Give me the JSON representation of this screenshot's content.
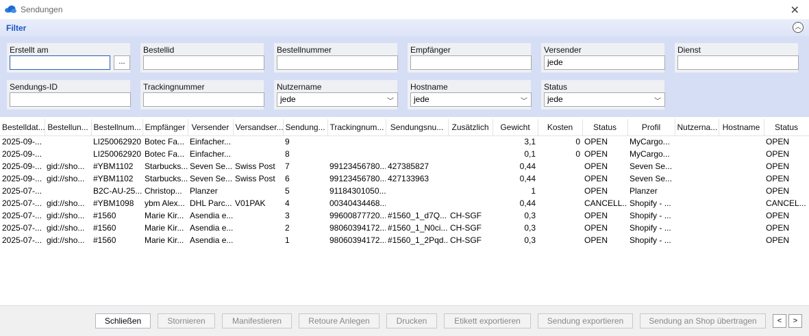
{
  "window": {
    "title": "Sendungen"
  },
  "filter": {
    "title": "Filter",
    "fields": {
      "erstellt_am": {
        "label": "Erstellt am",
        "value": ""
      },
      "bestellid": {
        "label": "Bestellid",
        "value": ""
      },
      "bestellnummer": {
        "label": "Bestellnummer",
        "value": ""
      },
      "empfaenger": {
        "label": "Empfänger",
        "value": ""
      },
      "versender": {
        "label": "Versender",
        "value": "jede"
      },
      "dienst": {
        "label": "Dienst",
        "value": ""
      },
      "sendungs_id": {
        "label": "Sendungs-ID",
        "value": ""
      },
      "trackingnummer": {
        "label": "Trackingnummer",
        "value": ""
      },
      "nutzername": {
        "label": "Nutzername",
        "value": "jede"
      },
      "hostname": {
        "label": "Hostname",
        "value": "jede"
      },
      "status": {
        "label": "Status",
        "value": "jede"
      }
    },
    "date_button": "..."
  },
  "table": {
    "columns": [
      "Bestelldat...",
      "Bestellun...",
      "Bestellnum...",
      "Empfänger",
      "Versender",
      "Versandser...",
      "Sendung...",
      "Trackingnum...",
      "Sendungsnu...",
      "Zusätzlich",
      "Gewicht",
      "Kosten",
      "Status",
      "Profil",
      "Nutzerna...",
      "Hostname",
      "Status"
    ],
    "rows": [
      [
        "2025-09-...",
        "",
        "LI250062920",
        "Botec Fa...",
        "Einfacher...",
        "",
        "9",
        "",
        "",
        "",
        "3,1",
        "0",
        "OPEN",
        "MyCargo...",
        "",
        "",
        "OPEN"
      ],
      [
        "2025-09-...",
        "",
        "LI250062920",
        "Botec Fa...",
        "Einfacher...",
        "",
        "8",
        "",
        "",
        "",
        "0,1",
        "0",
        "OPEN",
        "MyCargo...",
        "",
        "",
        "OPEN"
      ],
      [
        "2025-09-...",
        "gid://sho...",
        "#YBM1102",
        "Starbucks...",
        "Seven Se...",
        "Swiss Post",
        "7",
        "99123456780...",
        "427385827",
        "",
        "0,44",
        "",
        "OPEN",
        "Seven Se...",
        "",
        "",
        "OPEN"
      ],
      [
        "2025-09-...",
        "gid://sho...",
        "#YBM1102",
        "Starbucks...",
        "Seven Se...",
        "Swiss Post",
        "6",
        "99123456780...",
        "427133963",
        "",
        "0,44",
        "",
        "OPEN",
        "Seven Se...",
        "",
        "",
        "OPEN"
      ],
      [
        "2025-07-...",
        "",
        "B2C-AU-25...",
        "Christop...",
        "Planzer",
        "",
        "5",
        "91184301050...",
        "",
        "",
        "1",
        "",
        "OPEN",
        "Planzer",
        "",
        "",
        "OPEN"
      ],
      [
        "2025-07-...",
        "gid://sho...",
        "#YBM1098",
        "ybm Alex...",
        "DHL Parc...",
        "V01PAK",
        "4",
        "00340434468...",
        "",
        "",
        "0,44",
        "",
        "CANCELL...",
        "Shopify - ...",
        "",
        "",
        "CANCEL..."
      ],
      [
        "2025-07-...",
        "gid://sho...",
        "#1560",
        "Marie Kir...",
        "Asendia e...",
        "",
        "3",
        "99600877720...",
        "#1560_1_d7Q...",
        "CH-SGF",
        "0,3",
        "",
        "OPEN",
        "Shopify - ...",
        "",
        "",
        "OPEN"
      ],
      [
        "2025-07-...",
        "gid://sho...",
        "#1560",
        "Marie Kir...",
        "Asendia e...",
        "",
        "2",
        "98060394172...",
        "#1560_1_N0ci...",
        "CH-SGF",
        "0,3",
        "",
        "OPEN",
        "Shopify - ...",
        "",
        "",
        "OPEN"
      ],
      [
        "2025-07-...",
        "gid://sho...",
        "#1560",
        "Marie Kir...",
        "Asendia e...",
        "",
        "1",
        "98060394172...",
        "#1560_1_2Pqd...",
        "CH-SGF",
        "0,3",
        "",
        "OPEN",
        "Shopify - ...",
        "",
        "",
        "OPEN"
      ]
    ]
  },
  "footer": {
    "close": "Schließen",
    "cancel": "Stornieren",
    "manifest": "Manifestieren",
    "return": "Retoure Anlegen",
    "print": "Drucken",
    "export_label": "Etikett exportieren",
    "export_shipment": "Sendung exportieren",
    "transfer": "Sendung an Shop übertragen",
    "prev": "<",
    "next": ">"
  },
  "icons": {
    "app": "cloud-icon",
    "close": "close-icon",
    "collapse": "collapse-chevron-icon",
    "dropdown": "chevron-down-icon"
  },
  "colors": {
    "filter_title": "#1a56c4",
    "filter_panel": "#d6def5",
    "app_icon": "#2a7de1"
  }
}
